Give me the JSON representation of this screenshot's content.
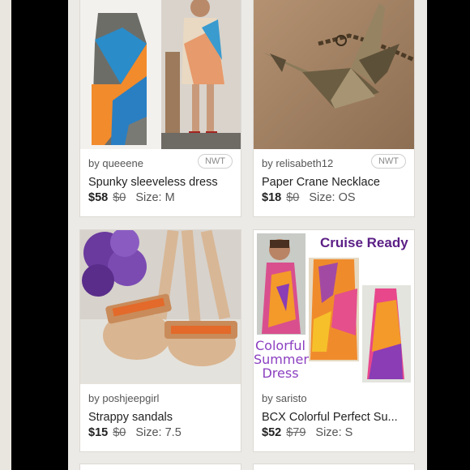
{
  "listings": [
    {
      "seller": "by queeene",
      "badge": "NWT",
      "title": "Spunky sleeveless dress",
      "price": "$58",
      "original_price": "$0",
      "size": "Size: M"
    },
    {
      "seller": "by relisabeth12",
      "badge": "NWT",
      "title": "Paper Crane Necklace",
      "price": "$18",
      "original_price": "$0",
      "size": "Size: OS"
    },
    {
      "seller": "by poshjeepgirl",
      "badge": "",
      "title": "Strappy sandals",
      "price": "$15",
      "original_price": "$0",
      "size": "Size: 7.5"
    },
    {
      "seller": "by saristo",
      "badge": "",
      "title": "BCX Colorful Perfect Su...",
      "price": "$52",
      "original_price": "$79",
      "size": "Size: S",
      "image_text": {
        "headline": "Cruise Ready",
        "caption_line1": "Colorful",
        "caption_line2": "Summer",
        "caption_line3": "Dress"
      }
    }
  ],
  "colors": {
    "screen_bg": "#eceae6",
    "card_bg": "#ffffff",
    "text": "#222222",
    "muted": "#555555",
    "cruise_purple": "#5b1f86"
  }
}
